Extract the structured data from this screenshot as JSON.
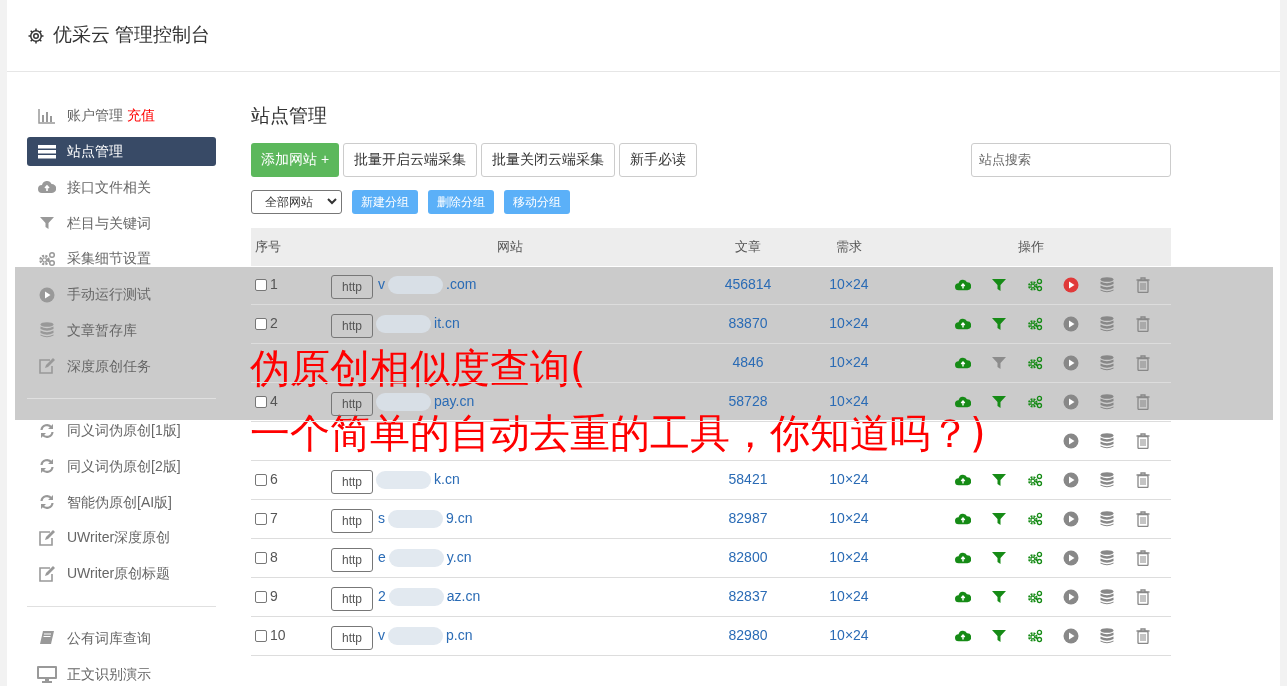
{
  "header": {
    "title": "优采云 管理控制台"
  },
  "sidebar": {
    "groups": [
      [
        {
          "label": "账户管理",
          "badge": "充值",
          "selected": false
        },
        {
          "label": "站点管理",
          "selected": true
        },
        {
          "label": "接口文件相关",
          "selected": false
        },
        {
          "label": "栏目与关键词",
          "selected": false
        },
        {
          "label": "采集细节设置",
          "selected": false
        },
        {
          "label": "手动运行测试",
          "selected": false
        },
        {
          "label": "文章暂存库",
          "selected": false
        },
        {
          "label": "深度原创任务",
          "selected": false
        }
      ],
      [
        {
          "label": "同义词伪原创[1版]",
          "selected": false
        },
        {
          "label": "同义词伪原创[2版]",
          "selected": false
        },
        {
          "label": "智能伪原创[AI版]",
          "selected": false
        },
        {
          "label": "UWriter深度原创",
          "selected": false
        },
        {
          "label": "UWriter原创标题",
          "selected": false
        }
      ],
      [
        {
          "label": "公有词库查询",
          "selected": false
        },
        {
          "label": "正文识别演示",
          "selected": false
        }
      ]
    ]
  },
  "page_title": "站点管理",
  "toolbar": {
    "primary": "添加网站 +",
    "buttons": [
      "批量开启云端采集",
      "批量关闭云端采集",
      "新手必读"
    ],
    "search_placeholder": "站点搜索"
  },
  "filter": {
    "select": "全部网站",
    "buttons": [
      "新建分组",
      "删除分组",
      "移动分组"
    ]
  },
  "table": {
    "columns": [
      "序号",
      "网站",
      "文章",
      "需求",
      "操作"
    ],
    "rows": [
      {
        "kind": "full",
        "no": "1",
        "checked": false,
        "scheme": "http",
        "prefix": "v",
        "suffix": ".com",
        "articles": "456814",
        "demand": "10×24",
        "filter_on": true,
        "running": true
      },
      {
        "kind": "full",
        "no": "2",
        "checked": false,
        "scheme": "http",
        "suffix": "it.cn",
        "articles": "83870",
        "demand": "10×24",
        "filter_on": true,
        "running": false
      },
      {
        "kind": "full",
        "articles": "4846",
        "demand": "10×24",
        "filter_on": false,
        "running": false
      },
      {
        "kind": "full",
        "no": "4",
        "checked": false,
        "scheme": "http",
        "suffix": "pay.cn",
        "articles": "58728",
        "demand": "10×24",
        "filter_on": true,
        "running": false
      },
      {
        "kind": "covered",
        "running": false
      },
      {
        "kind": "full",
        "no": "6",
        "checked": false,
        "scheme": "http",
        "suffix": "k.cn",
        "articles": "58421",
        "demand": "10×24",
        "filter_on": true,
        "running": false
      },
      {
        "kind": "full",
        "no": "7",
        "checked": false,
        "scheme": "http",
        "prefix": "s",
        "suffix": "9.cn",
        "articles": "82987",
        "demand": "10×24",
        "filter_on": true,
        "running": false
      },
      {
        "kind": "full",
        "no": "8",
        "checked": false,
        "scheme": "http",
        "prefix": "e",
        "suffix": "y.cn",
        "articles": "82800",
        "demand": "10×24",
        "filter_on": true,
        "running": false
      },
      {
        "kind": "full",
        "no": "9",
        "checked": false,
        "scheme": "http",
        "prefix": "2",
        "suffix": "az.cn",
        "articles": "82837",
        "demand": "10×24",
        "filter_on": true,
        "running": false
      },
      {
        "kind": "full",
        "no": "10",
        "checked": false,
        "scheme": "http",
        "prefix": "v",
        "suffix": "p.cn",
        "articles": "82980",
        "demand": "10×24",
        "filter_on": true,
        "running": false
      }
    ]
  },
  "banner": {
    "lines": [
      "伪原创相似度查询(",
      "一个简单的自动去重的工具，你知道吗？)"
    ]
  }
}
